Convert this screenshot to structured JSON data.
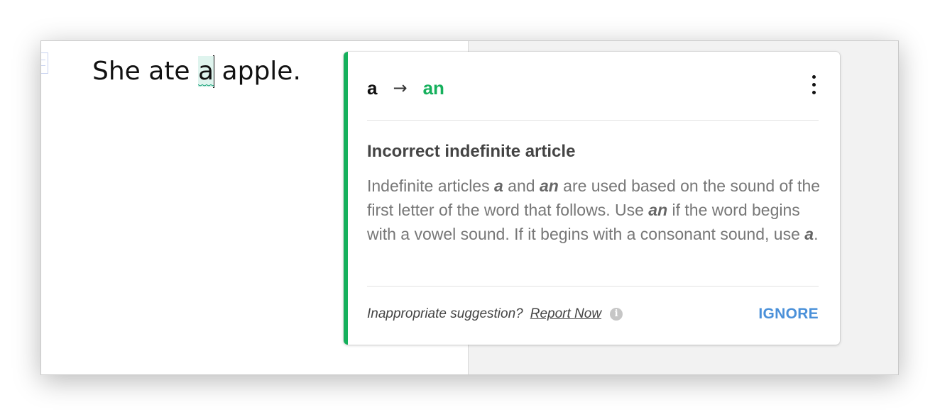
{
  "document": {
    "text_before": "She ate ",
    "flagged_word": "a",
    "text_after": " apple."
  },
  "suggestion": {
    "from": "a",
    "arrow": "→",
    "to": "an",
    "title": "Incorrect indefinite article",
    "body": {
      "p1": "Indefinite articles ",
      "e1": "a",
      "p2": " and ",
      "e2": "an",
      "p3": " are used based on the sound of the first letter of the word that follows. Use ",
      "e3": "an",
      "p4": " if the word begins with a vowel sound. If it begins with a consonant sound, use ",
      "e4": "a",
      "p5": "."
    },
    "footer": {
      "question": "Inappropriate suggestion?",
      "report_label": "Report Now",
      "info_icon": "i",
      "ignore_label": "IGNORE"
    }
  },
  "colors": {
    "accent_green": "#15b05c",
    "ignore_blue": "#4a90d9",
    "highlight": "#dff4ee"
  }
}
